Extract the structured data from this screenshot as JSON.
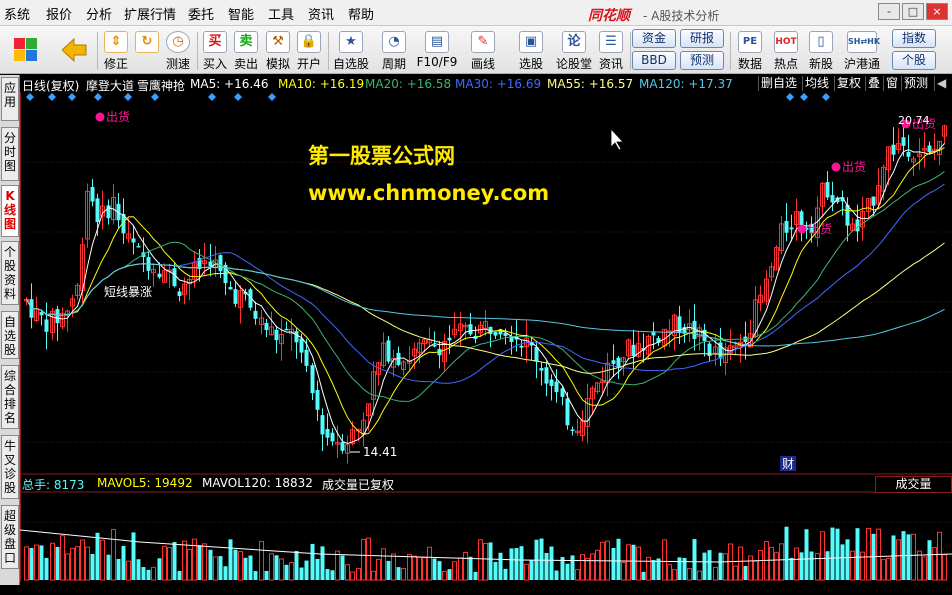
{
  "menu": [
    "系统",
    "报价",
    "分析",
    "扩展行情",
    "委托",
    "智能",
    "工具",
    "资讯",
    "帮助"
  ],
  "logo": "同花顺",
  "app_subtitle": "- A股技术分析",
  "window_buttons": [
    "-",
    "□",
    "×"
  ],
  "toolbar": {
    "tools": [
      {
        "label": "",
        "icon": "color-grid-icon"
      },
      {
        "label": "",
        "icon": "back-arrow-icon"
      },
      {
        "label": "修正",
        "icon": "up-down-icon"
      },
      {
        "label": "测速",
        "icon": "clock-icon"
      },
      {
        "label": "买入",
        "icon": "buy-icon"
      },
      {
        "label": "卖出",
        "icon": "sell-icon"
      },
      {
        "label": "模拟",
        "icon": "hammer-icon"
      },
      {
        "label": "开户",
        "icon": "lock-icon"
      },
      {
        "label": "自选股",
        "icon": "star-icon"
      },
      {
        "label": "周期",
        "icon": "cycle-icon"
      },
      {
        "label": "F10/F9",
        "icon": "f10-icon"
      },
      {
        "label": "画线",
        "icon": "pencil-icon"
      },
      {
        "label": "选股",
        "icon": "screen-icon"
      },
      {
        "label": "论股堂",
        "icon": "forum-icon"
      },
      {
        "label": "资讯",
        "icon": "news-icon"
      }
    ],
    "pills": [
      "资金",
      "研报",
      "BBD",
      "预测"
    ],
    "right_tools": [
      {
        "label": "数据",
        "icon": "pe-icon"
      },
      {
        "label": "热点",
        "icon": "hot-icon"
      },
      {
        "label": "新股",
        "icon": "new-stock-icon"
      },
      {
        "label": "沪港通",
        "icon": "hk-icon"
      }
    ],
    "far_right": [
      "指数",
      "个股"
    ]
  },
  "left_tabs": [
    "应用",
    "分时图",
    "K线图",
    "个股资料",
    "自选股",
    "综合排名",
    "牛叉诊股",
    "超级盘口"
  ],
  "chart_header": {
    "period": "日线(复权)",
    "name1": "摩登大道",
    "name2": "雪鹰神抢",
    "ma5": "MA5: +16.46",
    "ma10": "MA10: +16.19",
    "ma20": "MA20: +16.58",
    "ma30": "MA30: +16.69",
    "ma55": "MA55: +16.57",
    "ma120": "MA120: +17.37",
    "buttons": [
      "删自选",
      "均线",
      "复权",
      "叠",
      "窗",
      "预测"
    ]
  },
  "annotations": {
    "sell1": "出货",
    "sell2": "出货",
    "sell3": "出货",
    "sell4": "出货",
    "short_rise": "短线暴涨",
    "low_price": "14.41",
    "high_price": "20.74",
    "fin_mark": "财"
  },
  "watermark": {
    "line1": "第一股票公式网",
    "line2": "www.chnmoney.com"
  },
  "volume_header": {
    "total": "总手: 8173",
    "mavol5": "MAVOL5: 19492",
    "mavol120": "MAVOL120: 18832",
    "note": "成交量已复权",
    "tab": "成交量"
  },
  "colors": {
    "up": "#ff3232",
    "down": "#54fcfc",
    "ma5": "#ffffff",
    "ma10": "#ffff00",
    "ma20": "#3cb371",
    "ma30": "#4169ff",
    "ma55": "#ffff80",
    "ma120": "#55c8e6",
    "signal": "#ff1493"
  }
}
